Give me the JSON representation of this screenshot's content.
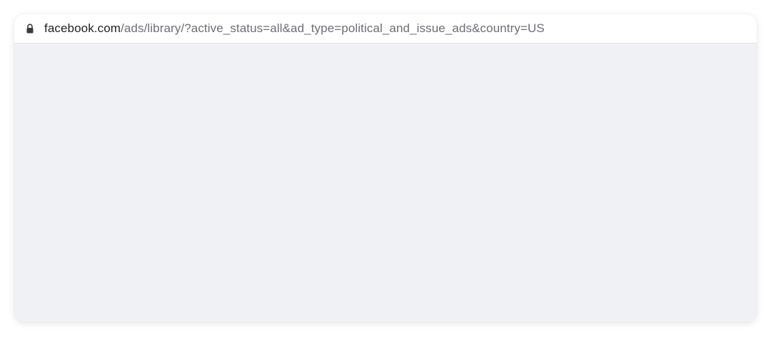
{
  "address_bar": {
    "url_domain": "facebook.com",
    "url_path": "/ads/library/?active_status=all&ad_type=political_and_issue_ads&country=US",
    "lock_icon": "lock-icon"
  },
  "colors": {
    "page_background": "#f0f1f4",
    "address_bar_background": "#ffffff",
    "domain_text": "#1f2023",
    "path_text": "#6b6e73"
  }
}
